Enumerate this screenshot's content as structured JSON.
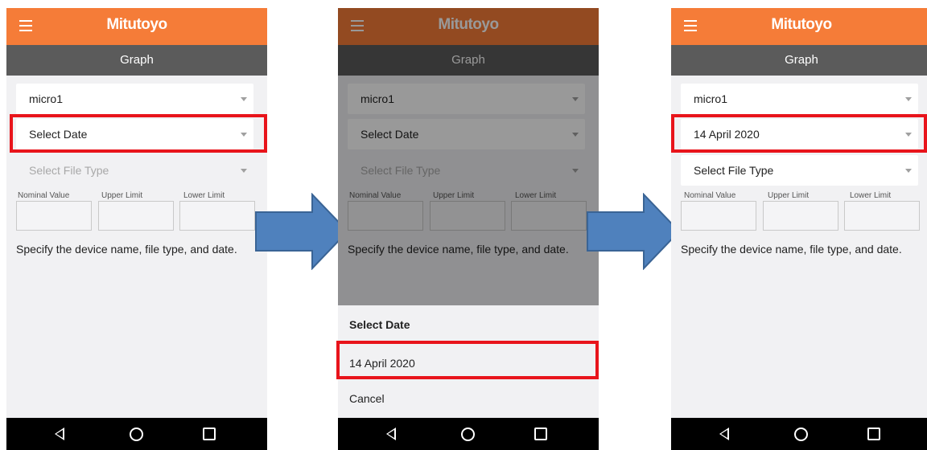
{
  "brand": "Mitutoyo",
  "screen_title": "Graph",
  "device_dropdown": "micro1",
  "date_dropdown_placeholder": "Select Date",
  "date_dropdown_selected": "14 April 2020",
  "file_type_placeholder": "Select File Type",
  "limits": {
    "nominal": "Nominal Value",
    "upper": "Upper Limit",
    "lower": "Lower Limit"
  },
  "message": "Specify the device name, file type, and date.",
  "sheet": {
    "title": "Select Date",
    "option": "14 April 2020",
    "cancel": "Cancel"
  },
  "colors": {
    "app_bar": "#f57c38",
    "sub_bar": "#5b5b5b",
    "highlight": "#e8141b",
    "arrow": "#4f81bd"
  }
}
